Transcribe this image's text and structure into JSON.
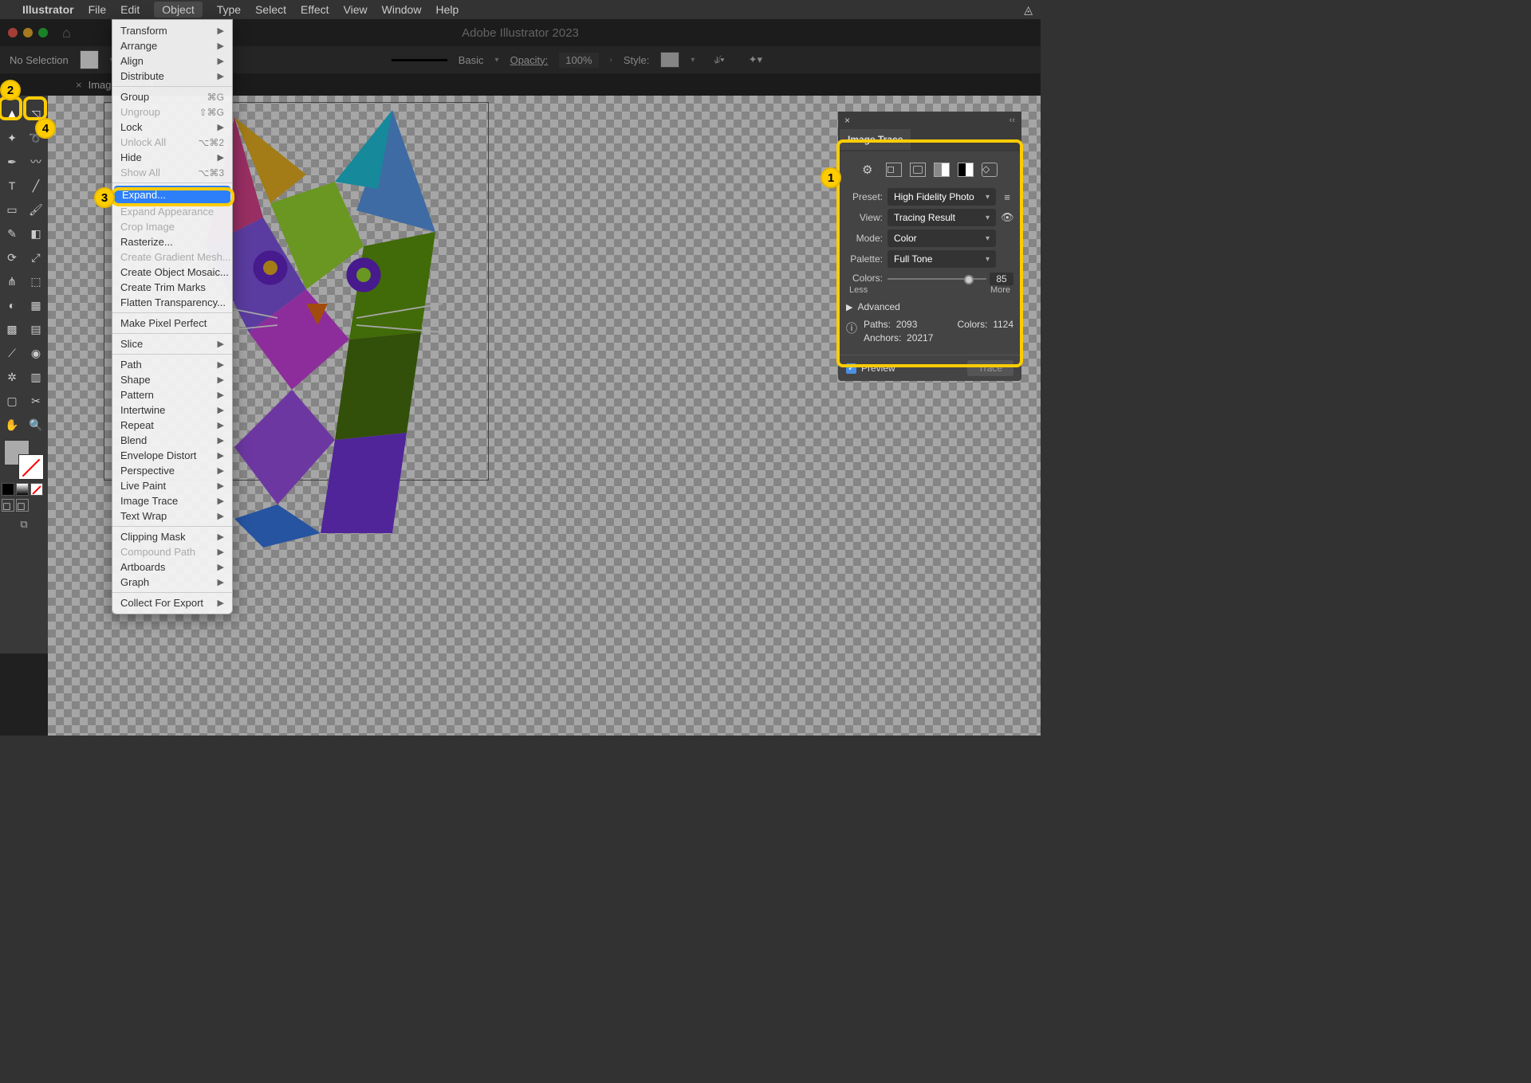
{
  "menubar": {
    "apple": "",
    "appname": "Illustrator",
    "items": [
      "File",
      "Edit",
      "Object",
      "Type",
      "Select",
      "Effect",
      "View",
      "Window",
      "Help"
    ]
  },
  "titlebar": {
    "title": "Adobe Illustrator 2023"
  },
  "optionsbar": {
    "selection": "No Selection",
    "stroke_style": "Basic",
    "opacity_label": "Opacity:",
    "opacity_value": "100%",
    "style_label": "Style:"
  },
  "tab": {
    "close": "×",
    "name": "Image.png* @"
  },
  "dropdown": {
    "groups": [
      [
        {
          "label": "Transform",
          "arrow": true
        },
        {
          "label": "Arrange",
          "arrow": true
        },
        {
          "label": "Align",
          "arrow": true
        },
        {
          "label": "Distribute",
          "arrow": true
        }
      ],
      [
        {
          "label": "Group",
          "shortcut": "⌘G"
        },
        {
          "label": "Ungroup",
          "shortcut": "⇧⌘G",
          "disabled": true
        },
        {
          "label": "Lock",
          "arrow": true
        },
        {
          "label": "Unlock All",
          "shortcut": "⌥⌘2",
          "disabled": true
        },
        {
          "label": "Hide",
          "arrow": true
        },
        {
          "label": "Show All",
          "shortcut": "⌥⌘3",
          "disabled": true
        }
      ],
      [
        {
          "label": "Expand...",
          "highlighted": true
        },
        {
          "label": "Expand Appearance",
          "disabled": true
        },
        {
          "label": "Crop Image",
          "disabled": true
        },
        {
          "label": "Rasterize..."
        },
        {
          "label": "Create Gradient Mesh...",
          "disabled": true
        },
        {
          "label": "Create Object Mosaic..."
        },
        {
          "label": "Create Trim Marks"
        },
        {
          "label": "Flatten Transparency..."
        }
      ],
      [
        {
          "label": "Make Pixel Perfect"
        }
      ],
      [
        {
          "label": "Slice",
          "arrow": true
        }
      ],
      [
        {
          "label": "Path",
          "arrow": true
        },
        {
          "label": "Shape",
          "arrow": true
        },
        {
          "label": "Pattern",
          "arrow": true
        },
        {
          "label": "Intertwine",
          "arrow": true
        },
        {
          "label": "Repeat",
          "arrow": true
        },
        {
          "label": "Blend",
          "arrow": true
        },
        {
          "label": "Envelope Distort",
          "arrow": true
        },
        {
          "label": "Perspective",
          "arrow": true
        },
        {
          "label": "Live Paint",
          "arrow": true
        },
        {
          "label": "Image Trace",
          "arrow": true
        },
        {
          "label": "Text Wrap",
          "arrow": true
        }
      ],
      [
        {
          "label": "Clipping Mask",
          "arrow": true
        },
        {
          "label": "Compound Path",
          "arrow": true,
          "disabled": true
        },
        {
          "label": "Artboards",
          "arrow": true
        },
        {
          "label": "Graph",
          "arrow": true
        }
      ],
      [
        {
          "label": "Collect For Export",
          "arrow": true
        }
      ]
    ]
  },
  "panel": {
    "title": "Image Trace",
    "preset_label": "Preset:",
    "preset_value": "High Fidelity Photo",
    "view_label": "View:",
    "view_value": "Tracing Result",
    "mode_label": "Mode:",
    "mode_value": "Color",
    "palette_label": "Palette:",
    "palette_value": "Full Tone",
    "colors_label": "Colors:",
    "colors_value": "85",
    "less": "Less",
    "more": "More",
    "advanced": "Advanced",
    "paths_label": "Paths:",
    "paths_value": "2093",
    "colors2_label": "Colors:",
    "colors2_value": "1124",
    "anchors_label": "Anchors:",
    "anchors_value": "20217",
    "preview": "Preview",
    "trace": "Trace"
  },
  "callouts": {
    "c1": "1",
    "c2": "2",
    "c3": "3",
    "c4": "4"
  }
}
